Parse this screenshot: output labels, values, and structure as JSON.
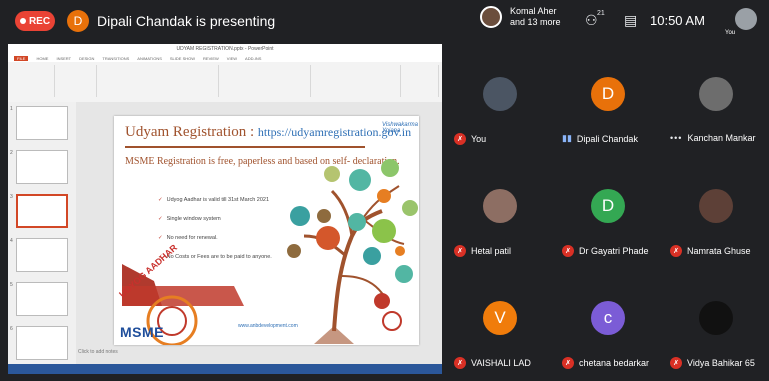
{
  "topbar": {
    "rec_label": "REC",
    "presenter_initial": "D",
    "presenting_text": "Dipali Chandak is presenting",
    "people_line1": "Komal Aher",
    "people_line2": "and 13 more",
    "people_count": "21",
    "time": "10:50 AM",
    "you_label": "You"
  },
  "powerpoint": {
    "window_title": "UDYAM REGISTRATION.pptx - PowerPoint",
    "tabs": [
      "FILE",
      "HOME",
      "INSERT",
      "DESIGN",
      "TRANSITIONS",
      "ANIMATIONS",
      "SLIDE SHOW",
      "REVIEW",
      "VIEW",
      "ADD-INS"
    ],
    "slide_numbers": [
      "1",
      "2",
      "3",
      "4",
      "5",
      "6"
    ],
    "notes_placeholder": "Click to add notes",
    "slide": {
      "title": "Udyam Registration : ",
      "title_url": "https://udyamregistration.gov.in",
      "subtitle": "MSME Registration is free, paperless and based on self- declaration.",
      "bullets": [
        "Udyog Aadhar is valid till 31st March 2021",
        "Single window system",
        "No need for renewal.",
        "No Costs or Fees are to be paid to anyone."
      ],
      "footer_url": "www.anbdevelopment.com",
      "udyog_aadhar": "UDYOG AADHAR",
      "msme": "MSME",
      "logo_text": "Vishwakarma Yojana"
    }
  },
  "participants": [
    {
      "name": "You",
      "initial": "",
      "color": "#4b5563",
      "mic": "muted"
    },
    {
      "name": "Dipali Chandak",
      "initial": "D",
      "color": "#e8710a",
      "mic": "live"
    },
    {
      "name": "Kanchan Mankar",
      "initial": "",
      "color": "#6d6d6d",
      "mic": "dots"
    },
    {
      "name": "Hetal patil",
      "initial": "",
      "color": "#8d6e63",
      "mic": "muted"
    },
    {
      "name": "Dr Gayatri Phade",
      "initial": "D",
      "color": "#34a853",
      "mic": "muted"
    },
    {
      "name": "Namrata Ghuse",
      "initial": "",
      "color": "#5d4037",
      "mic": "muted"
    },
    {
      "name": "VAISHALI LAD",
      "initial": "V",
      "color": "#f07c0b",
      "mic": "muted"
    },
    {
      "name": "chetana bedarkar",
      "initial": "c",
      "color": "#7b5cd6",
      "mic": "muted"
    },
    {
      "name": "Vidya Bahikar 65",
      "initial": "",
      "color": "#111111",
      "mic": "muted"
    }
  ]
}
